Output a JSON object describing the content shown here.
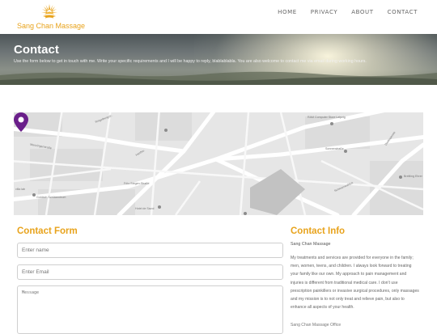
{
  "brand": {
    "name": "Sang Chan Massage",
    "icon": "sun-lotus-icon",
    "accent_color": "#e8a31c"
  },
  "nav": {
    "items": [
      {
        "label": "HOME"
      },
      {
        "label": "PRIVACY"
      },
      {
        "label": "ABOUT"
      },
      {
        "label": "CONTACT"
      }
    ]
  },
  "hero": {
    "title": "Contact",
    "subtitle": "Use the form below to get in touch with me. Write your specific requirements and I will be happy to reply, blablablabla. You are also welcome to contact me via email during working hours."
  },
  "map": {
    "pin_icon": "map-pin-icon",
    "pin_color": "#6a1f8a",
    "street_labels": [
      "Ringelbergstr.",
      "Menzingerstraße",
      "Hanfstr.",
      "Fritz-Stegen-Straße",
      "Hotel de Savoi",
      "Sonnenstraße",
      "Schwarzwaldstr.",
      "Breitling Ehrer",
      "Goldach Schülzentrum",
      "RAM Computer Store Leipzig",
      "villa lab",
      "Dietlindenstr."
    ]
  },
  "contact_form": {
    "title": "Contact Form",
    "name_placeholder": "Enter name",
    "email_placeholder": "Enter Email",
    "message_placeholder": "Message"
  },
  "contact_info": {
    "title": "Contact Info",
    "name": "Sang Chan Massage",
    "body": "My treatments and services are provided for everyone in the family; men, women, teens, and children. I always look forward to treating your family like our own. My approach to pain management and injuries is different from traditional medical care. I don't use prescription painkillers or invasive surgical procedures, only massages and my mission is to not only treat and relieve pain, but also to enhance all aspects of your health.",
    "extra": "Sang Chan Massage Office"
  }
}
